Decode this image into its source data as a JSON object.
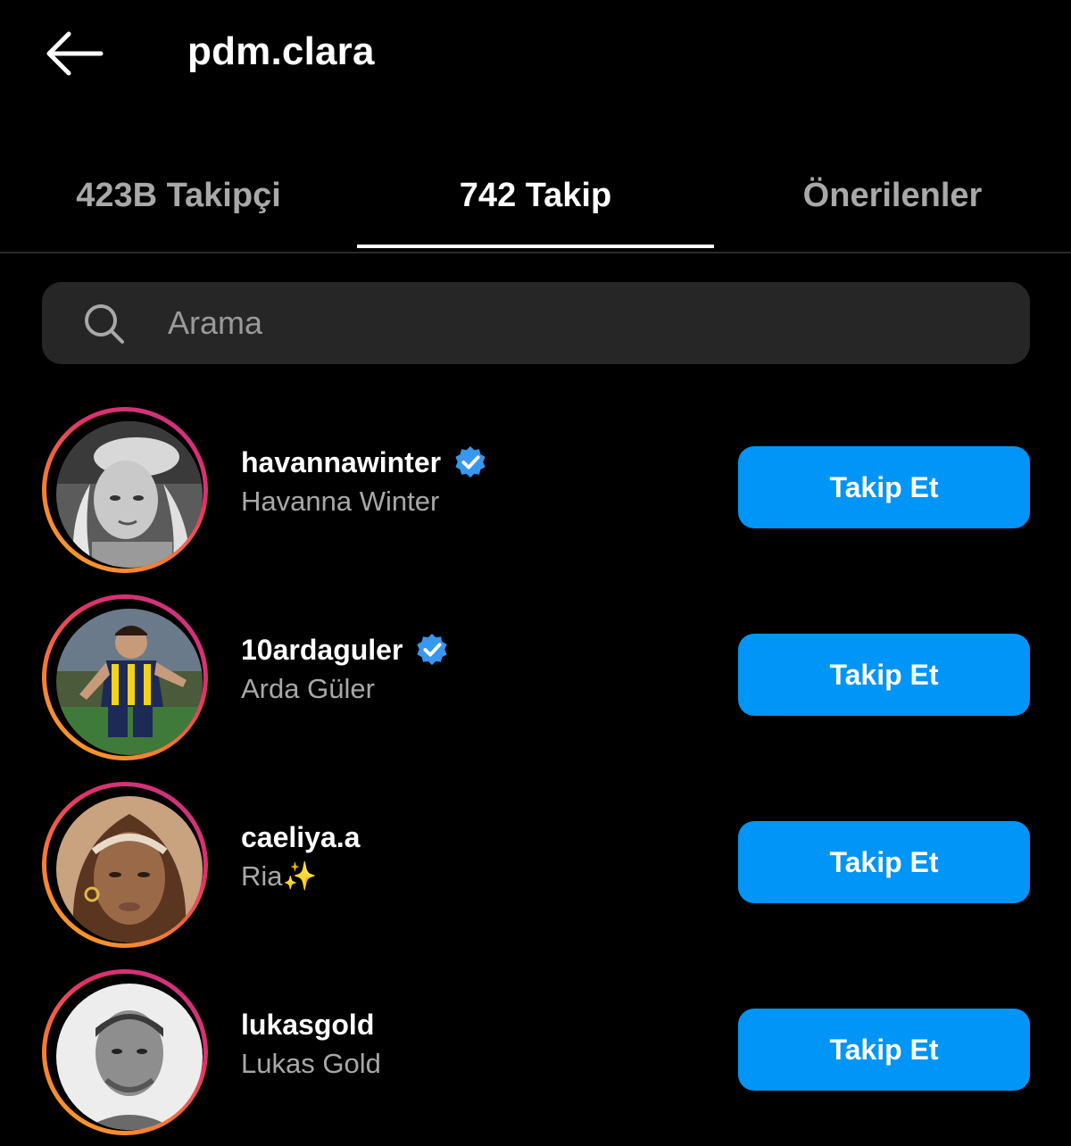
{
  "header": {
    "title": "pdm.clara",
    "back_icon": "arrow-left-icon"
  },
  "tabs": [
    {
      "label": "423B Takipçi",
      "active": false
    },
    {
      "label": "742 Takip",
      "active": true
    },
    {
      "label": "Önerilenler",
      "active": false
    }
  ],
  "search": {
    "placeholder": "Arama",
    "icon": "search-icon"
  },
  "colors": {
    "background": "#000000",
    "button": "#0095f6",
    "verified": "#3897f0",
    "secondary_text": "#a8a8a8",
    "search_bg": "#262626"
  },
  "users": [
    {
      "username": "havannawinter",
      "full_name": "Havanna Winter",
      "verified": true,
      "button_label": "Takip Et"
    },
    {
      "username": "10ardaguler",
      "full_name": "Arda Güler",
      "verified": true,
      "button_label": "Takip Et"
    },
    {
      "username": "caeliya.a",
      "full_name": "Ria✨",
      "verified": false,
      "button_label": "Takip Et"
    },
    {
      "username": "lukasgold",
      "full_name": "Lukas Gold",
      "verified": false,
      "button_label": "Takip Et"
    }
  ]
}
